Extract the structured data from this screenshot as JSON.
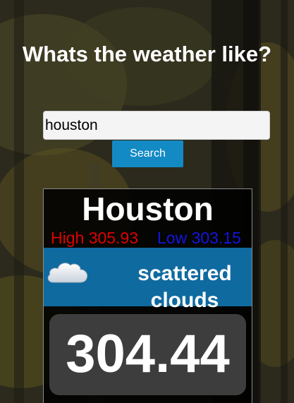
{
  "header": {
    "title": "Whats the weather like?"
  },
  "search": {
    "value": "houston",
    "button_label": "Search"
  },
  "weather": {
    "city": "Houston",
    "high_label": "High",
    "high": "305.93",
    "low_label": "Low",
    "low": "303.15",
    "condition": "scattered clouds",
    "condition_icon": "cloud-icon",
    "temperature": "304.44"
  },
  "colors": {
    "search_button": "#138ac4",
    "condition_bar": "#0f6aa0",
    "high": "#e00000",
    "low": "#1414e0",
    "temp_box": "#3d3d3d"
  }
}
